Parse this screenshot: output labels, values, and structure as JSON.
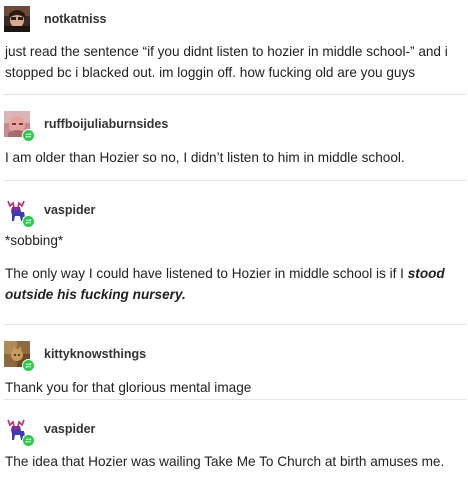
{
  "posts": [
    {
      "username": "notkatniss",
      "avatar_icon": "photo-avatar-icon",
      "reblog": false,
      "text": "just read the sentence “if you didnt listen to hozier in middle school-” and i stopped bc i blacked out. im loggin off. how fucking old are you guys"
    },
    {
      "username": "ruffboijuliaburnsides",
      "avatar_icon": "photo-avatar-icon",
      "reblog": true,
      "text": "I am older than Hozier so no, I didn’t listen to him in middle school."
    },
    {
      "username": "vaspider",
      "avatar_icon": "moose-avatar-icon",
      "reblog": true,
      "text_lines": [
        "*sobbing*"
      ],
      "text_prefix": "The only way I could have listened to Hozier in middle school is if I ",
      "text_emphasis": "stood outside his fucking nursery."
    },
    {
      "username": "kittyknowsthings",
      "avatar_icon": "photo-avatar-icon",
      "reblog": true,
      "text": "Thank you for that glorious mental image"
    },
    {
      "username": "vaspider",
      "avatar_icon": "moose-avatar-icon",
      "reblog": true,
      "text": "The idea that Hozier was wailing Take Me To Church at birth amuses me."
    }
  ],
  "colors": {
    "reblog_badge": "#2ec74a",
    "divider": "#e4e4e4",
    "username": "#333333",
    "text": "#222222"
  }
}
